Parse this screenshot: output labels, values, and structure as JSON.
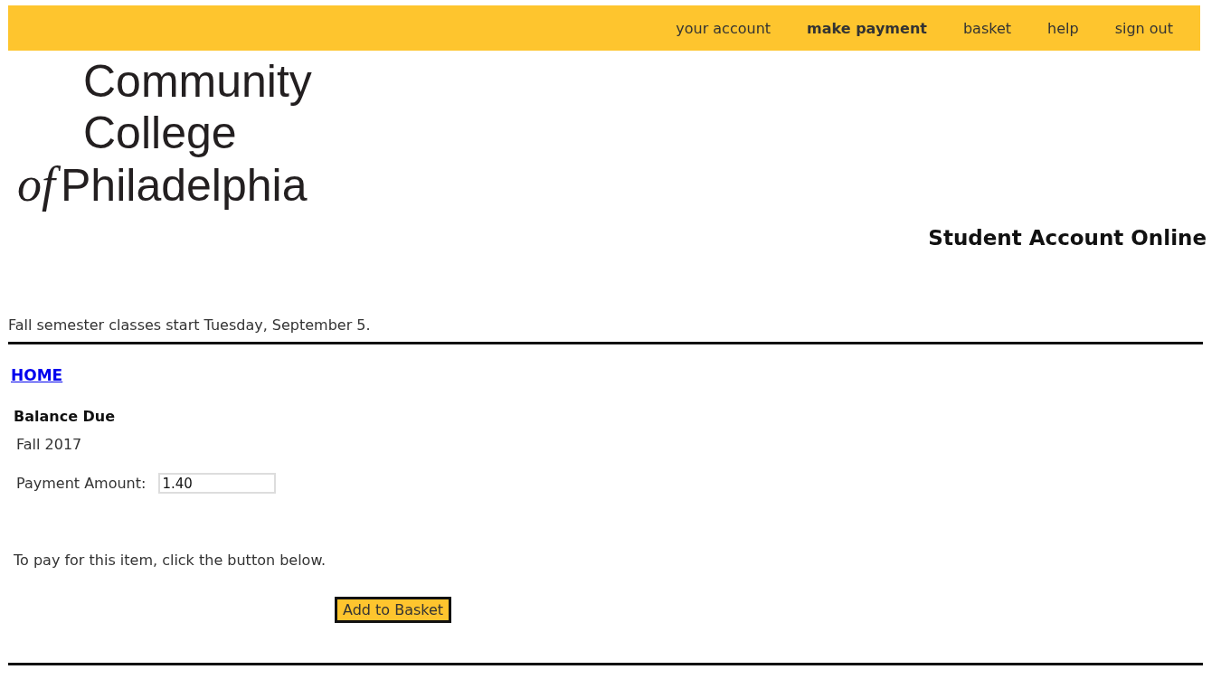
{
  "nav": [
    {
      "label": "your account",
      "selected": false
    },
    {
      "label": "make payment",
      "selected": true
    },
    {
      "label": "basket",
      "selected": false
    },
    {
      "label": "help",
      "selected": false
    },
    {
      "label": "sign out",
      "selected": false
    }
  ],
  "logo": {
    "line_1": "Community",
    "line_2": "College",
    "prefix": "of",
    "line_3": "Philadelphia"
  },
  "site_title": "Student Account Online",
  "notice": "Fall semester classes start Tuesday, September 5.",
  "home_link": "HOME",
  "section_title": "Balance Due",
  "term": "Fall 2017",
  "payment_field": {
    "label": "Payment Amount:",
    "value": "1.40"
  },
  "instruction": "To pay for this item, click the button below.",
  "button": "Add to Basket"
}
